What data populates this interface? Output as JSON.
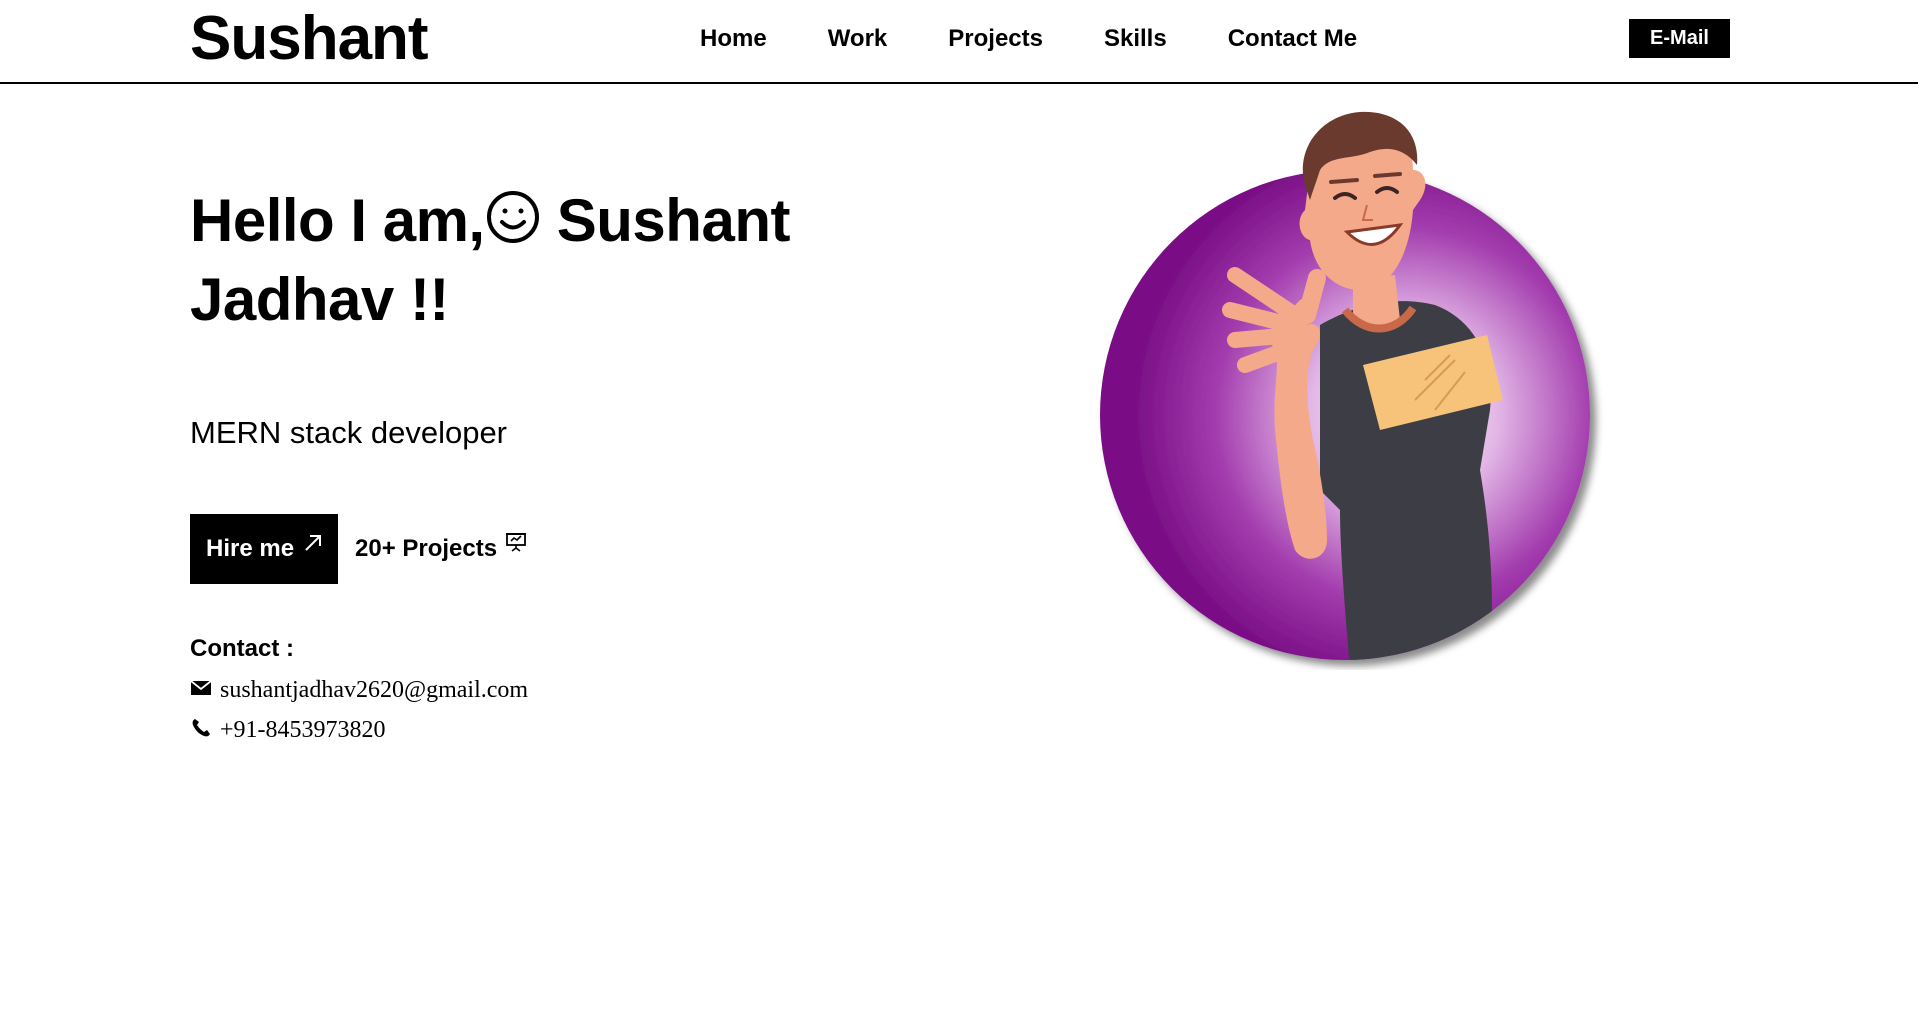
{
  "header": {
    "logo": "Sushant",
    "nav": [
      "Home",
      "Work",
      "Projects",
      "Skills",
      "Contact Me"
    ],
    "email_button": "E-Mail"
  },
  "hero": {
    "greeting": "Hello I am,",
    "name_part1": "Sushant",
    "name_part2": "Jadhav !!",
    "role": "MERN stack developer",
    "hire_button": "Hire me",
    "projects_label": "20+ Projects"
  },
  "contact": {
    "heading": "Contact :",
    "email": "sushantjadhav2620@gmail.com",
    "phone": "+91-8453973820"
  },
  "colors": {
    "accent_purple": "#7a0f86",
    "shirt": "#3d3d45",
    "shirt_patch": "#f7c27a",
    "skin": "#f4a98a"
  },
  "icons": [
    "smiley-icon",
    "arrow-up-right-icon",
    "presentation-icon",
    "mail-icon",
    "phone-icon"
  ]
}
